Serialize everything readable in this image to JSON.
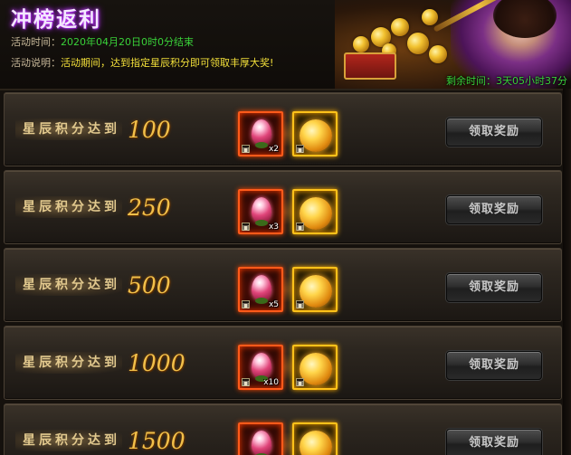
{
  "header": {
    "title": "冲榜返利",
    "time_label": "活动时间：",
    "time_value": "2020年04月20日0时0分结束",
    "desc_label": "活动说明：",
    "desc_value": "活动期间，达到指定星辰积分即可领取丰厚大奖!",
    "countdown_label": "剩余时间：",
    "countdown_value": "3天05小时37分"
  },
  "reward_rows": [
    {
      "label": "星辰积分达到",
      "value": "100",
      "gem_qty": "x2",
      "button": "领取奖励"
    },
    {
      "label": "星辰积分达到",
      "value": "250",
      "gem_qty": "x3",
      "button": "领取奖励"
    },
    {
      "label": "星辰积分达到",
      "value": "500",
      "gem_qty": "x5",
      "button": "领取奖励"
    },
    {
      "label": "星辰积分达到",
      "value": "1000",
      "gem_qty": "x10",
      "button": "领取奖励"
    },
    {
      "label": "星辰积分达到",
      "value": "1500",
      "gem_qty": "",
      "button": "领取奖励"
    }
  ],
  "icons": {
    "reward_1": "pink-crystal-gem-icon",
    "reward_2": "golden-orb-icon",
    "lock": "lock-icon"
  },
  "colors": {
    "title_glow": "#c63dff",
    "green_text": "#39d139",
    "yellow_text": "#f3e03a",
    "score_gold": "#f2c04a"
  }
}
